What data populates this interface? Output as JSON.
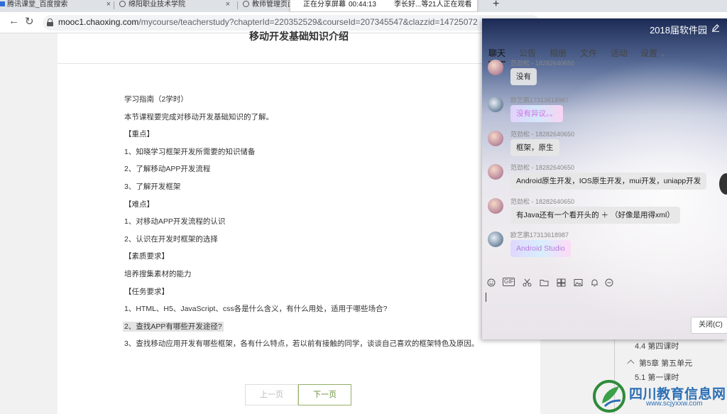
{
  "browser": {
    "tabs": [
      {
        "title": "腾讯课堂_百度搜索"
      },
      {
        "title": "绵阳职业技术学院"
      },
      {
        "title": "教师管理页面"
      }
    ],
    "url_host": "mooc1.chaoxing.com",
    "url_path": "/mycourse/teacherstudy?chapterId=220352529&courseId=207345547&clazzid=14725072",
    "new_tab": "+",
    "back": "←",
    "reload": "↻",
    "close_glyph": "×"
  },
  "share": {
    "status": "正在分享屏幕",
    "elapsed": "00:44:13",
    "viewers": "李长好...等21人正在观看"
  },
  "page": {
    "heading": "移动开发基础知识介绍",
    "guide_lines": [
      "学习指南（2学时）",
      "本节课程要完成对移动开发基础知识的了解。",
      "【重点】",
      "1、知晓学习框架开发所需要的知识储备",
      "2、了解移动APP开发流程",
      "3、了解开发框架",
      "【难点】",
      "1、对移动APP开发流程的认识",
      "2、认识在开发时框架的选择",
      "【素质要求】",
      "培养搜集素材的能力",
      "【任务要求】",
      "1、HTML、H5、JavaScript、css各是什么含义，有什么用处，适用于哪些场合?",
      "2、查找APP有哪些开发途径?",
      "3、查找移动应用开发有哪些框架，各有什么特点，若以前有接触的同学，谈谈自己喜欢的框架特色及原因。"
    ],
    "prev_label": "上一页",
    "next_label": "下一页"
  },
  "course_tree": {
    "items": [
      {
        "label": "4.4 第四课时"
      },
      {
        "label": "第5章 第五单元"
      },
      {
        "label": "5.1 第一课时"
      }
    ]
  },
  "watermark": {
    "title": "四川教育信息网",
    "url": "www.scjyxxw.com"
  },
  "chat": {
    "title": "2018届软件园",
    "tabs": [
      {
        "label": "聊天"
      },
      {
        "label": "公告"
      },
      {
        "label": "相册"
      },
      {
        "label": "文件"
      },
      {
        "label": "活动"
      },
      {
        "label": "设置"
      }
    ],
    "settings_chevron": "⌄",
    "messages": [
      {
        "sender": "范劲松 - 18282640650",
        "text": "没有"
      },
      {
        "sender": "欧艺鹏17313618987",
        "text": "没有异议。。"
      },
      {
        "sender": "范劲松 - 18282640650",
        "text": "框架，原生"
      },
      {
        "sender": "范劲松 - 18282640650",
        "text": "Android原生开发，IOS原生开发，mui开发，uniapp开发"
      },
      {
        "sender": "范劲松 - 18282640650",
        "text": "有Java还有一个看开头的 ＋ （好像是用得xml）"
      },
      {
        "sender": "欧艺鹏17313618987",
        "text": "Android Studio"
      }
    ],
    "toolbar_icons": [
      "smile-icon",
      "gif-icon",
      "scissors-icon",
      "folder-icon",
      "sticker-icon",
      "image-icon",
      "bell-icon",
      "more-icon"
    ],
    "gif_label": "GIF",
    "close_label": "关闭(C)"
  }
}
